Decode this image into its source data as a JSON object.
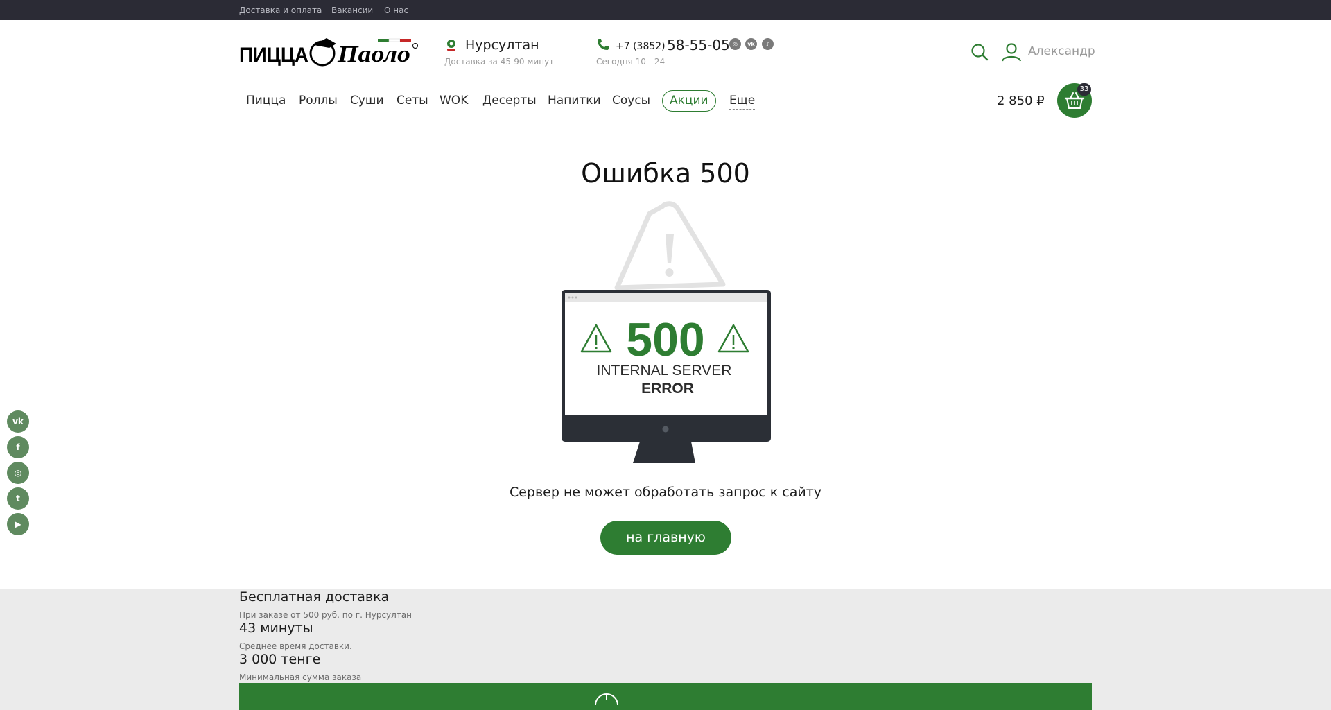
{
  "topbar": {
    "links": [
      "Доставка и оплата",
      "Вакансии",
      "О нас"
    ]
  },
  "header": {
    "logo_text": "ПИЦЦА Паоло",
    "city": "Нурсултан",
    "delivery_time": "Доставка за 45-90 минут",
    "phone_prefix": "+7 (3852)",
    "phone_number": "58-55-05",
    "hours": "Сегодня 10 - 24",
    "social_icons": [
      "instagram-icon",
      "vk-icon",
      "tiktok-icon"
    ],
    "user_name": "Александр"
  },
  "nav": {
    "items": [
      "Пицца",
      "Роллы",
      "Суши",
      "Сеты",
      "WOK",
      "Десерты",
      "Напитки",
      "Соусы"
    ],
    "promo": "Акции",
    "more": "Еще"
  },
  "cart": {
    "total": "2 850 ₽",
    "count": "33"
  },
  "main": {
    "title": "Ошибка 500",
    "illustration": {
      "code": "500",
      "line1": "INTERNAL SERVER",
      "line2": "ERROR"
    },
    "message": "Сервер не может обработать запрос к сайту",
    "home_button": "на главную"
  },
  "social_rail": [
    "vk-icon",
    "facebook-icon",
    "instagram-icon",
    "twitter-icon",
    "youtube-icon"
  ],
  "info": {
    "free_delivery_title": "Бесплатная доставка",
    "free_delivery_sub": "При заказе от 500 руб. по г. Нурсултан",
    "avg_time_title": "43 минуты",
    "avg_time_sub": "Среднее время доставки.",
    "min_order_title": "3 000 тенге",
    "min_order_sub": "Минимальная сумма заказа"
  },
  "colors": {
    "brand_green": "#2e7d32",
    "topbar_bg": "#2b2b35",
    "band_gray": "#ebebeb"
  }
}
